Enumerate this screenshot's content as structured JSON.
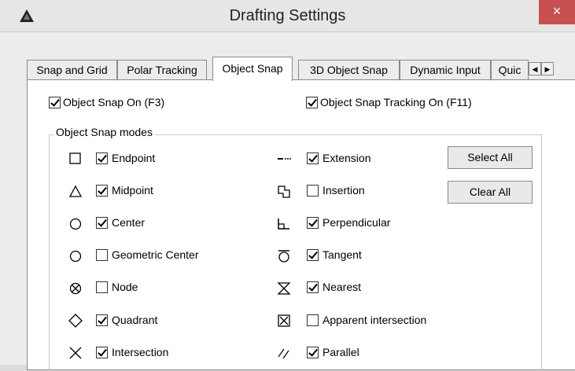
{
  "window": {
    "title": "Drafting Settings",
    "close_glyph": "×"
  },
  "tabs": [
    {
      "label": "Snap and Grid",
      "active": false
    },
    {
      "label": "Polar Tracking",
      "active": false
    },
    {
      "label": "Object Snap",
      "active": true
    },
    {
      "label": "3D Object Snap",
      "active": false
    },
    {
      "label": "Dynamic Input",
      "active": false
    },
    {
      "label": "Quic",
      "active": false
    }
  ],
  "tab_scroll": {
    "left": "◀",
    "right": "▶"
  },
  "top_options": {
    "object_snap_on": {
      "label": "Object Snap On (F3)",
      "checked": true
    },
    "object_snap_tracking_on": {
      "label": "Object Snap Tracking On (F11)",
      "checked": true
    }
  },
  "modes_group_label": "Object Snap modes",
  "modes_left": [
    {
      "label": "Endpoint",
      "checked": true,
      "icon": "square-icon"
    },
    {
      "label": "Midpoint",
      "checked": true,
      "icon": "triangle-icon"
    },
    {
      "label": "Center",
      "checked": true,
      "icon": "circle-icon"
    },
    {
      "label": "Geometric Center",
      "checked": false,
      "icon": "circle-icon"
    },
    {
      "label": "Node",
      "checked": false,
      "icon": "node-icon"
    },
    {
      "label": "Quadrant",
      "checked": true,
      "icon": "diamond-icon"
    },
    {
      "label": "Intersection",
      "checked": true,
      "icon": "x-icon"
    }
  ],
  "modes_right": [
    {
      "label": "Extension",
      "checked": true,
      "icon": "extension-icon"
    },
    {
      "label": "Insertion",
      "checked": false,
      "icon": "insertion-icon"
    },
    {
      "label": "Perpendicular",
      "checked": true,
      "icon": "perpendicular-icon"
    },
    {
      "label": "Tangent",
      "checked": true,
      "icon": "tangent-icon"
    },
    {
      "label": "Nearest",
      "checked": true,
      "icon": "hourglass-icon"
    },
    {
      "label": "Apparent intersection",
      "checked": false,
      "icon": "boxed-x-icon"
    },
    {
      "label": "Parallel",
      "checked": true,
      "icon": "parallel-icon"
    }
  ],
  "buttons": {
    "select_all": "Select All",
    "clear_all": "Clear All"
  }
}
